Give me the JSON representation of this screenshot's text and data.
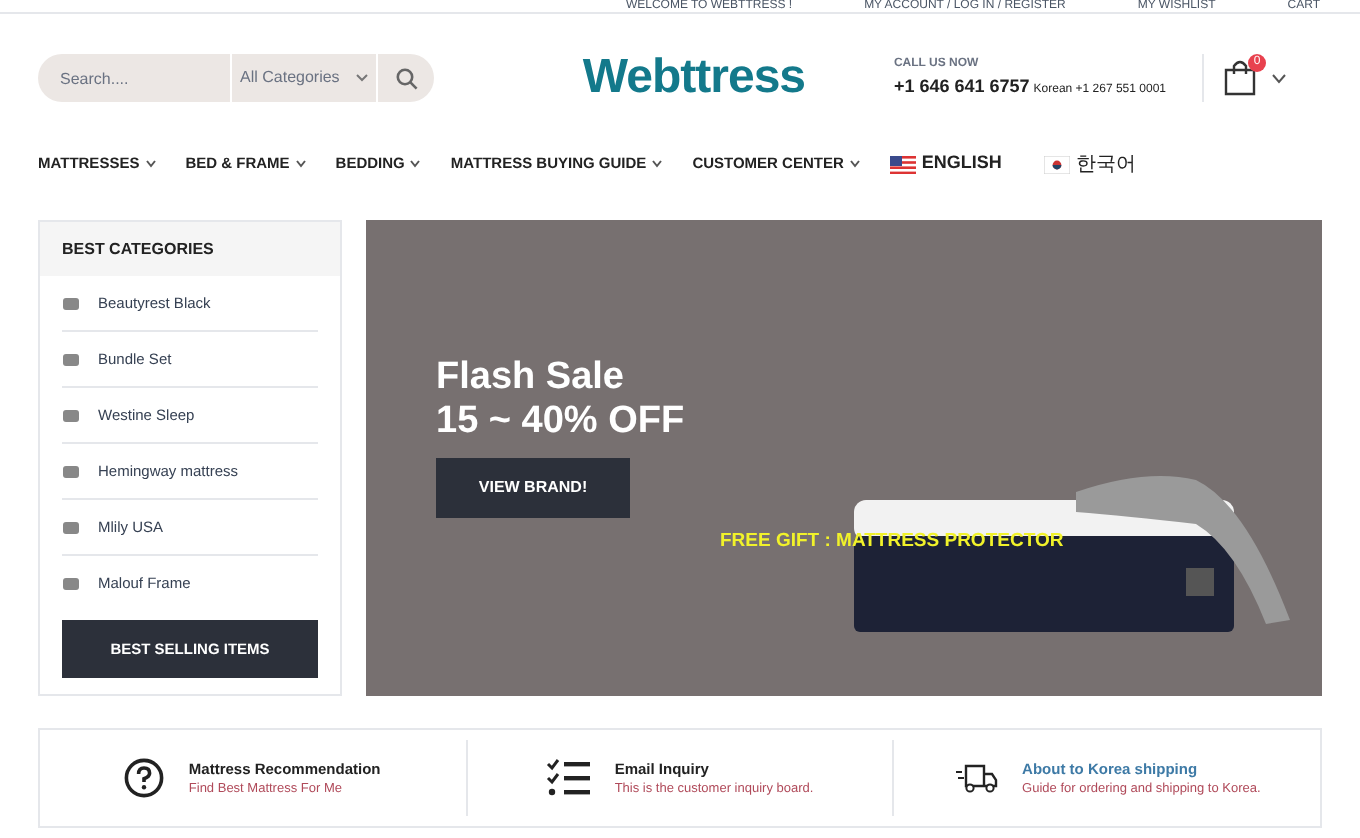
{
  "top_bar": {
    "links": [
      "WELCOME TO WEBTTRESS !",
      "MY ACCOUNT / LOG IN / REGISTER",
      "MY WISHLIST",
      "CART"
    ]
  },
  "search": {
    "placeholder": "Search....",
    "category": "All Categories"
  },
  "logo": "Webttress",
  "contact": {
    "label": "CALL US NOW",
    "phone": "+1 646 641 6757",
    "korea": "Korean +1 267 551 0001"
  },
  "cart": {
    "count": "0"
  },
  "nav": [
    {
      "label": "MATTRESSES",
      "kind": "menu"
    },
    {
      "label": "BED & FRAME",
      "kind": "menu"
    },
    {
      "label": "BEDDING",
      "kind": "menu"
    },
    {
      "label": "MATTRESS BUYING GUIDE",
      "kind": "menu"
    },
    {
      "label": "CUSTOMER CENTER",
      "kind": "menu"
    },
    {
      "label": "ENGLISH",
      "kind": "us"
    },
    {
      "label": "한국어",
      "kind": "kr"
    }
  ],
  "sidebar": {
    "title": "BEST CATEGORIES",
    "items": [
      "Beautyrest Black",
      "Bundle Set",
      "Westine Sleep",
      "Hemingway mattress",
      "Mlily USA",
      "Malouf Frame"
    ],
    "button": "BEST SELLING ITEMS"
  },
  "banner": {
    "title": "Flash Sale",
    "subtitle": "15 ~ 40% OFF",
    "button": "VIEW BRAND!",
    "gift": "FREE GIFT : MATTRESS PROTECTOR"
  },
  "features": [
    {
      "kind": "question",
      "title": "Mattress Recommendation",
      "text": "Find Best Mattress For Me",
      "highlighted": false
    },
    {
      "kind": "list",
      "title": "Email Inquiry",
      "text": "This is the customer inquiry board.",
      "highlighted": false
    },
    {
      "kind": "truck",
      "title": "About to Korea shipping",
      "text": "Guide for ordering and shipping to Korea.",
      "highlighted": true
    }
  ]
}
